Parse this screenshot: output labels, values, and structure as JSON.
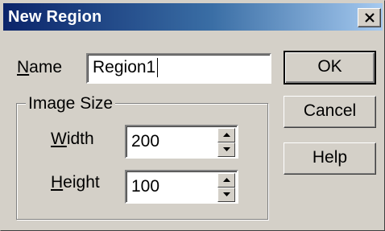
{
  "dialog": {
    "title": "New Region",
    "close_label": "Close"
  },
  "name_field": {
    "label_mnemonic": "N",
    "label_rest": "ame",
    "value": "Region1"
  },
  "image_size": {
    "group_label": "Image Size",
    "width": {
      "label_mnemonic": "W",
      "label_rest": "idth",
      "value": "200"
    },
    "height": {
      "label_mnemonic": "H",
      "label_rest": "eight",
      "value": "100"
    }
  },
  "buttons": {
    "ok": "OK",
    "cancel": "Cancel",
    "help": "Help"
  },
  "icons": {
    "close": "close-icon",
    "spin_up": "spin-up-arrow-icon",
    "spin_down": "spin-down-arrow-icon"
  },
  "colors": {
    "titlebar_start": "#0a246a",
    "titlebar_end": "#a6caf0",
    "face": "#d4d0c8"
  }
}
